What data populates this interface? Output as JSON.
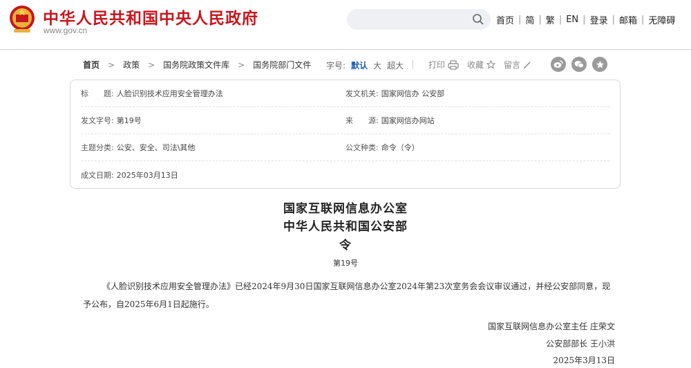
{
  "header": {
    "site_title": "中华人民共和国中央人民政府",
    "site_url": "www.gov.cn",
    "search": {
      "placeholder": "",
      "icon": "search-icon"
    },
    "nav": [
      "首页",
      "简",
      "繁",
      "EN",
      "登录",
      "邮箱",
      "无障碍"
    ],
    "brand_color": "#c8161d"
  },
  "breadcrumb": [
    "首页",
    "政策",
    "国务院政策文件库",
    "国务院部门文件"
  ],
  "font_size": {
    "label": "字号:",
    "options": [
      "默认",
      "大",
      "超大"
    ],
    "selected": "默认"
  },
  "tools": {
    "print": "打印",
    "favorite": "收藏",
    "comment": "留言"
  },
  "share_icons": [
    "weibo-icon",
    "wechat-icon",
    "star-icon"
  ],
  "metadata": {
    "title_label": "标　　题:",
    "title_value": "人脸识别技术应用安全管理办法",
    "issuer_label": "发文机关:",
    "issuer_value": "国家网信办  公安部",
    "doc_no_label": "发文字号:",
    "doc_no_value": "第19号",
    "source_label": "来　　源:",
    "source_value": "国家网信办网站",
    "topic_label": "主题分类:",
    "topic_value": "公安、安全、司法\\其他",
    "type_label": "公文种类:",
    "type_value": "命令（令）",
    "date_label": "成文日期:",
    "date_value": "2025年03月13日"
  },
  "article": {
    "issuer_line1": "国家互联网信息办公室",
    "issuer_line2": "中华人民共和国公安部",
    "order": "令",
    "number": "第19号",
    "body": "《人脸识别技术应用安全管理办法》已经2024年9月30日国家互联网信息办公室2024年第23次室务会会议审议通过，并经公安部同意，现予公布，自2025年6月1日起施行。",
    "signature1": "国家互联网信息办公室主任  庄荣文",
    "signature2": "公安部部长  王小洪",
    "date": "2025年3月13日"
  }
}
